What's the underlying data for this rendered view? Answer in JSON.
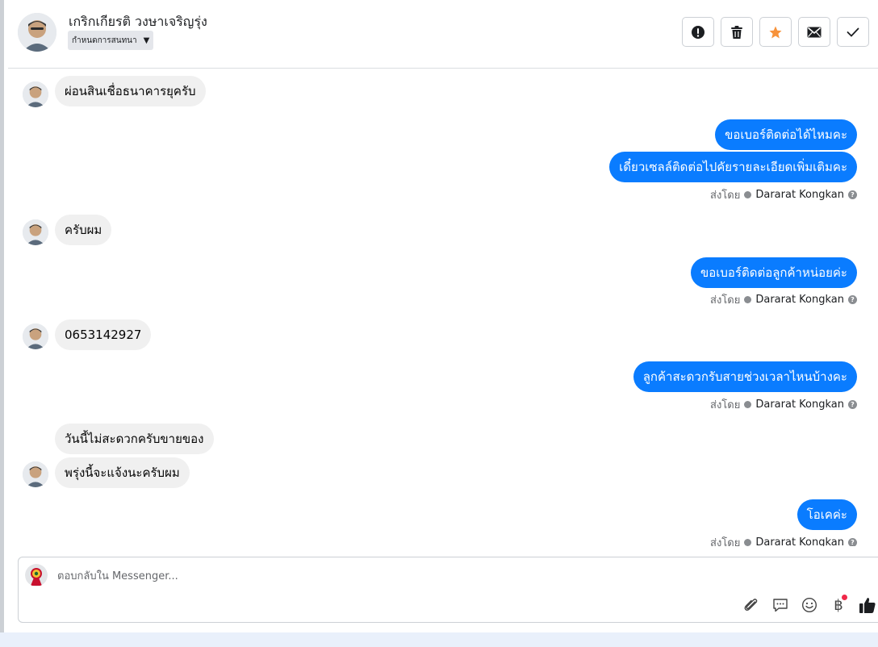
{
  "header": {
    "customer_name": "เกริกเกียรติ วงษาเจริญรุ่ง",
    "conversation_tag": "กำหนดการสนทนา",
    "actions": [
      {
        "name": "mark-spam",
        "icon": "alert-circle-icon"
      },
      {
        "name": "delete",
        "icon": "trash-icon"
      },
      {
        "name": "star",
        "icon": "star-icon",
        "color": "#f7923a"
      },
      {
        "name": "mark-unread",
        "icon": "envelope-icon"
      },
      {
        "name": "mark-done",
        "icon": "checkmark-icon"
      }
    ]
  },
  "messages": [
    {
      "dir": "in",
      "text": "ผ่อนสินเชื่อธนาคารยุครับ"
    },
    {
      "dir": "out",
      "text": "ขอเบอร์ติดต่อได้ไหมคะ"
    },
    {
      "dir": "out",
      "text": "เดี๋ยวเซลล์ติดต่อไปคัยรายละเอียดเพิ่มเติมคะ"
    },
    {
      "dir": "in",
      "text": "ครับผม"
    },
    {
      "dir": "out",
      "text": "ขอเบอร์ติดต่อลูกค้าหน่อยค่ะ"
    },
    {
      "dir": "in",
      "text": "0653142927"
    },
    {
      "dir": "out",
      "text": "ลูกค้าสะดวกรับสายช่วงเวลาไหนบ้างคะ"
    },
    {
      "dir": "in",
      "text": "วันนี้ไม่สะดวกครับขายของ"
    },
    {
      "dir": "in",
      "text": "พรุ่งนี้จะแจ้งนะครับผม"
    },
    {
      "dir": "out",
      "text": "โอเคค่ะ"
    }
  ],
  "sent_by": {
    "label": "ส่งโดย",
    "agent": "Dararat Kongkan"
  },
  "reply": {
    "placeholder": "ตอบกลับใน Messenger...",
    "tools": [
      "paperclip-icon",
      "saved-reply-icon",
      "emoji-icon",
      "baht-icon",
      "thumbs-up-icon"
    ],
    "baht_symbol": "฿"
  },
  "colors": {
    "outgoing_bubble": "#0a7cff",
    "incoming_bubble": "#f0f0f0",
    "star": "#f7923a",
    "notification_dot": "#f02849"
  }
}
